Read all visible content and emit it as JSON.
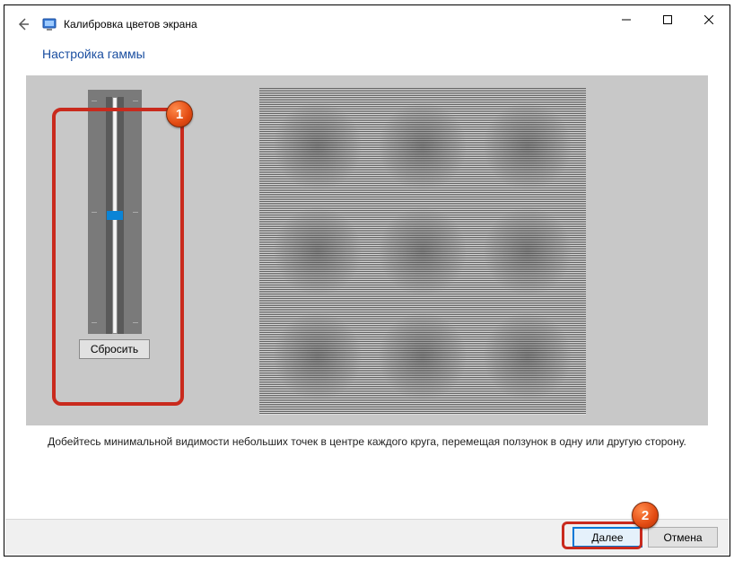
{
  "window": {
    "title": "Калибровка цветов экрана"
  },
  "page": {
    "heading": "Настройка гаммы",
    "instruction": "Добейтесь минимальной видимости небольших точек в центре каждого круга, перемещая ползунок в одну или другую сторону."
  },
  "controls": {
    "reset": "Сбросить",
    "next": "Далее",
    "cancel": "Отмена"
  },
  "annotations": {
    "marker1": "1",
    "marker2": "2"
  }
}
